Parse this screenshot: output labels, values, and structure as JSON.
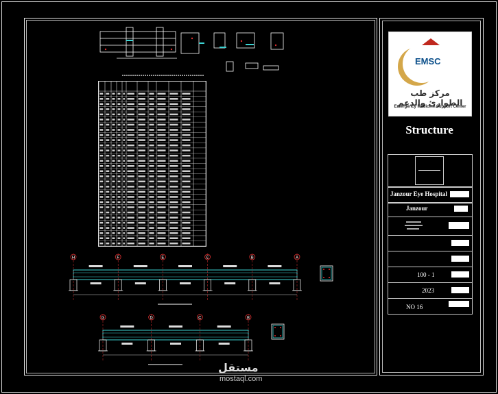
{
  "titleblock": {
    "logo_arabic": "مركز طب الطوارئ والدعم",
    "logo_abbr": "EMSC",
    "logo_en": "Emergency Medicine Support Center",
    "drawing_title": "Structure",
    "project_name": "Janzour Eye Hospital",
    "location": "Janzour",
    "sheet_code": "100 - 1",
    "year": "2023",
    "sheet_no": "NO 16"
  },
  "watermark": {
    "arabic": "مستقل",
    "site": "mostaql.com"
  },
  "schedule_rows": 30,
  "grid_labels_top": [
    "H",
    "F",
    "E",
    "C",
    "B",
    "A"
  ],
  "grid_labels_bottom": [
    "G",
    "D",
    "C",
    "B"
  ],
  "colors": {
    "line": "#ffffff",
    "beam": "#3dd4d4",
    "axis": "#e03030",
    "accent_gold": "#d4a74a",
    "accent_blue": "#0b4f8a"
  }
}
